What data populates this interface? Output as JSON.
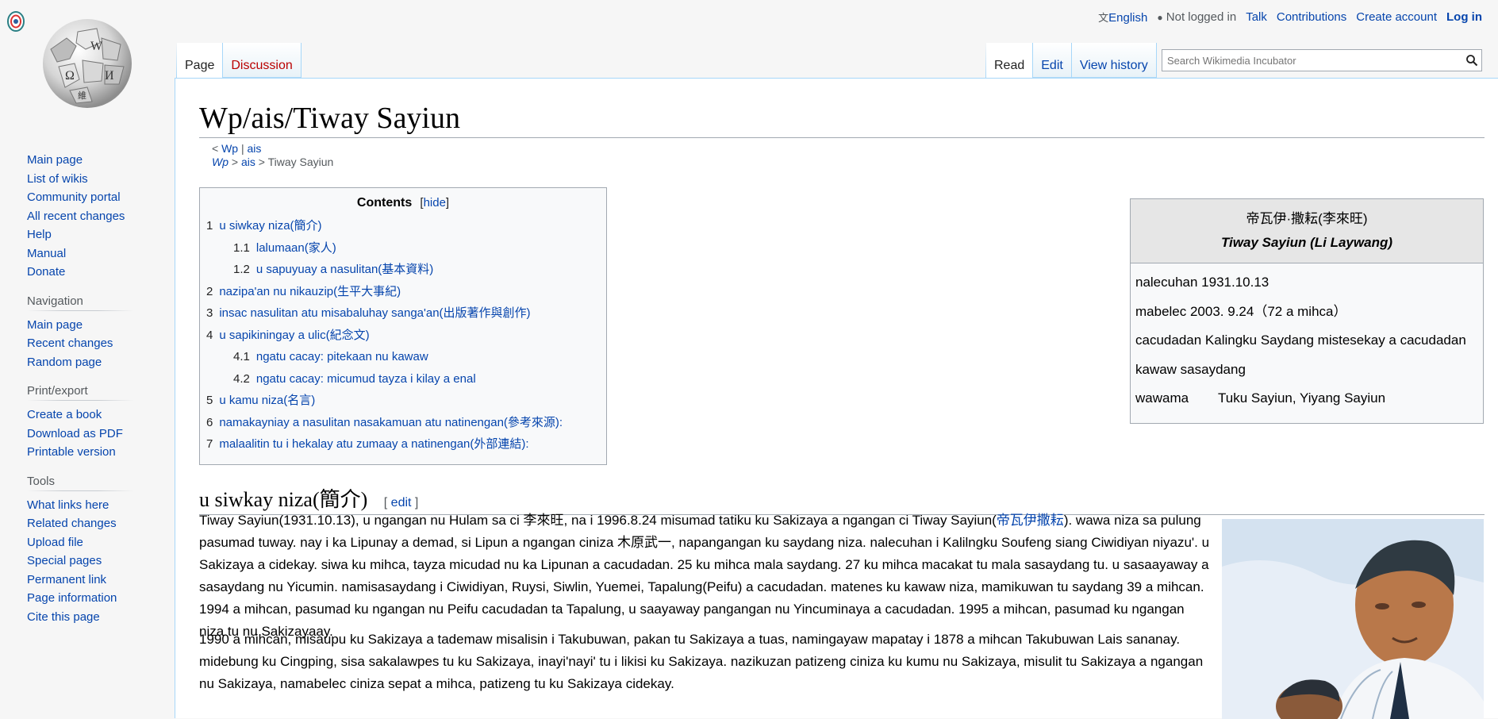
{
  "personal": {
    "language": "English",
    "not_logged_in": "Not logged in",
    "talk": "Talk",
    "contributions": "Contributions",
    "create_account": "Create account",
    "log_in": "Log in"
  },
  "tabs": {
    "page": "Page",
    "discussion": "Discussion",
    "read": "Read",
    "edit": "Edit",
    "view_history": "View history"
  },
  "search": {
    "placeholder": "Search Wikimedia Incubator"
  },
  "sidebar": {
    "main": [
      "Main page",
      "List of wikis",
      "Community portal",
      "All recent changes",
      "Help",
      "Manual",
      "Donate"
    ],
    "navigation": {
      "heading": "Navigation",
      "items": [
        "Main page",
        "Recent changes",
        "Random page"
      ]
    },
    "print": {
      "heading": "Print/export",
      "items": [
        "Create a book",
        "Download as PDF",
        "Printable version"
      ]
    },
    "tools": {
      "heading": "Tools",
      "items": [
        "What links here",
        "Related changes",
        "Upload file",
        "Special pages",
        "Permanent link",
        "Page information",
        "Cite this page"
      ]
    }
  },
  "page": {
    "title": "Wp/ais/Tiway Sayiun",
    "subpages_line1": {
      "lt": "< ",
      "wp": "Wp",
      "sep": " | ",
      "ais": "ais"
    },
    "subpages_line2": {
      "wp": "Wp",
      "gt1": " > ",
      "ais": "ais",
      "gt2": " > Tiway Sayiun"
    }
  },
  "toc": {
    "title": "Contents",
    "toggle": "hide",
    "items": [
      {
        "num": "1",
        "text": "u siwkay niza(簡介)",
        "level": 1
      },
      {
        "num": "1.1",
        "text": "lalumaan(家人)",
        "level": 2
      },
      {
        "num": "1.2",
        "text": "u sapuyuay a nasulitan(基本資料)",
        "level": 2
      },
      {
        "num": "2",
        "text": "nazipa'an nu nikauzip(生平大事紀)",
        "level": 1
      },
      {
        "num": "3",
        "text": "insac nasulitan atu misabaluhay sanga'an(出版著作與創作)",
        "level": 1
      },
      {
        "num": "4",
        "text": "u sapikiningay a ulic(紀念文)",
        "level": 1
      },
      {
        "num": "4.1",
        "text": "ngatu cacay: pitekaan nu kawaw",
        "level": 2
      },
      {
        "num": "4.2",
        "text": "ngatu cacay: micumud tayza i kilay a enal",
        "level": 2
      },
      {
        "num": "5",
        "text": "u kamu niza(名言)",
        "level": 1
      },
      {
        "num": "6",
        "text": "namakayniay a nasulitan nasakamuan atu natinengan(參考來源):",
        "level": 1
      },
      {
        "num": "7",
        "text": "malaalitin tu i hekalay atu zumaay a natinengan(外部連結):",
        "level": 1
      }
    ]
  },
  "infobox": {
    "title_zh": "帝瓦伊·撒耘(李來旺)",
    "title_en": "Tiway Sayiun (Li Laywang)",
    "rows": [
      "nalecuhan 1931.10.13",
      "mabelec 2003. 9.24（72 a mihca）",
      "cacudadan Kalingku Saydang mistesekay a cacudadan",
      "kawaw sasaydang"
    ],
    "parents_label": "wawama",
    "parents_value": "Tuku Sayiun, Yiyang Sayiun"
  },
  "section": {
    "heading": "u siwkay niza(簡介)",
    "edit_open": "[ ",
    "edit": "edit",
    "edit_close": " ]"
  },
  "paragraphs": {
    "p1_a": "Tiway Sayiun(1931.10.13), u ngangan nu Hulam sa ci 李來旺, na i 1996.8.24 misumad tatiku ku Sakizaya a ngangan ci Tiway Sayiun(",
    "p1_link": "帝瓦伊撒耘",
    "p1_b": "). wawa niza sa pulung pasumad tuway. nay i ka Lipunay a demad, si Lipun a ngangan ciniza 木原武一, napangangan ku saydang niza. nalecuhan i Kalilngku Soufeng siang Ciwidiyan niyazu'. u Sakizaya a cidekay. siwa ku mihca, tayza micudad nu ka Lipunan a cacudadan. 25 ku mihca mala saydang. 27 ku mihca macakat tu mala sasaydang tu. u sasaayaway a sasaydang nu Yicumin. namisasaydang i Ciwidiyan, Ruysi, Siwlin, Yuemei, Tapalung(Peifu) a cacudadan. matenes ku kawaw niza, mamikuwan tu saydang 39 a mihcan. 1994 a mihcan, pasumad ku ngangan nu Peifu cacudadan ta Tapalung, u saayaway pangangan nu Yincuminaya a cacudadan. 1995 a mihcan, pasumad ku ngangan niza tu nu Sakizayaay.",
    "p2": "1990 a mihcan, misaupu ku Sakizaya a tademaw misalisin i Takubuwan, pakan tu Sakizaya a tuas, namingayaw mapatay i 1878 a mihcan Takubuwan Lais sananay. midebung ku Cingping, sisa sakalawpes tu ku Sakizaya, inayi'nayi' tu i likisi ku Sakizaya. nazikuzan patizeng ciniza ku kumu nu Sakizaya, misulit tu Sakizaya a ngangan nu Sakizaya, namabelec ciniza sepat a mihca, patizeng tu ku Sakizaya cidekay."
  },
  "colors": {
    "link": "#0645ad",
    "new_link": "#ba0000",
    "border": "#a2a9b1",
    "tab_border": "#a7d7f9"
  },
  "icons": {
    "language": "translate-icon",
    "user": "user-icon",
    "search": "magnifier-icon"
  }
}
